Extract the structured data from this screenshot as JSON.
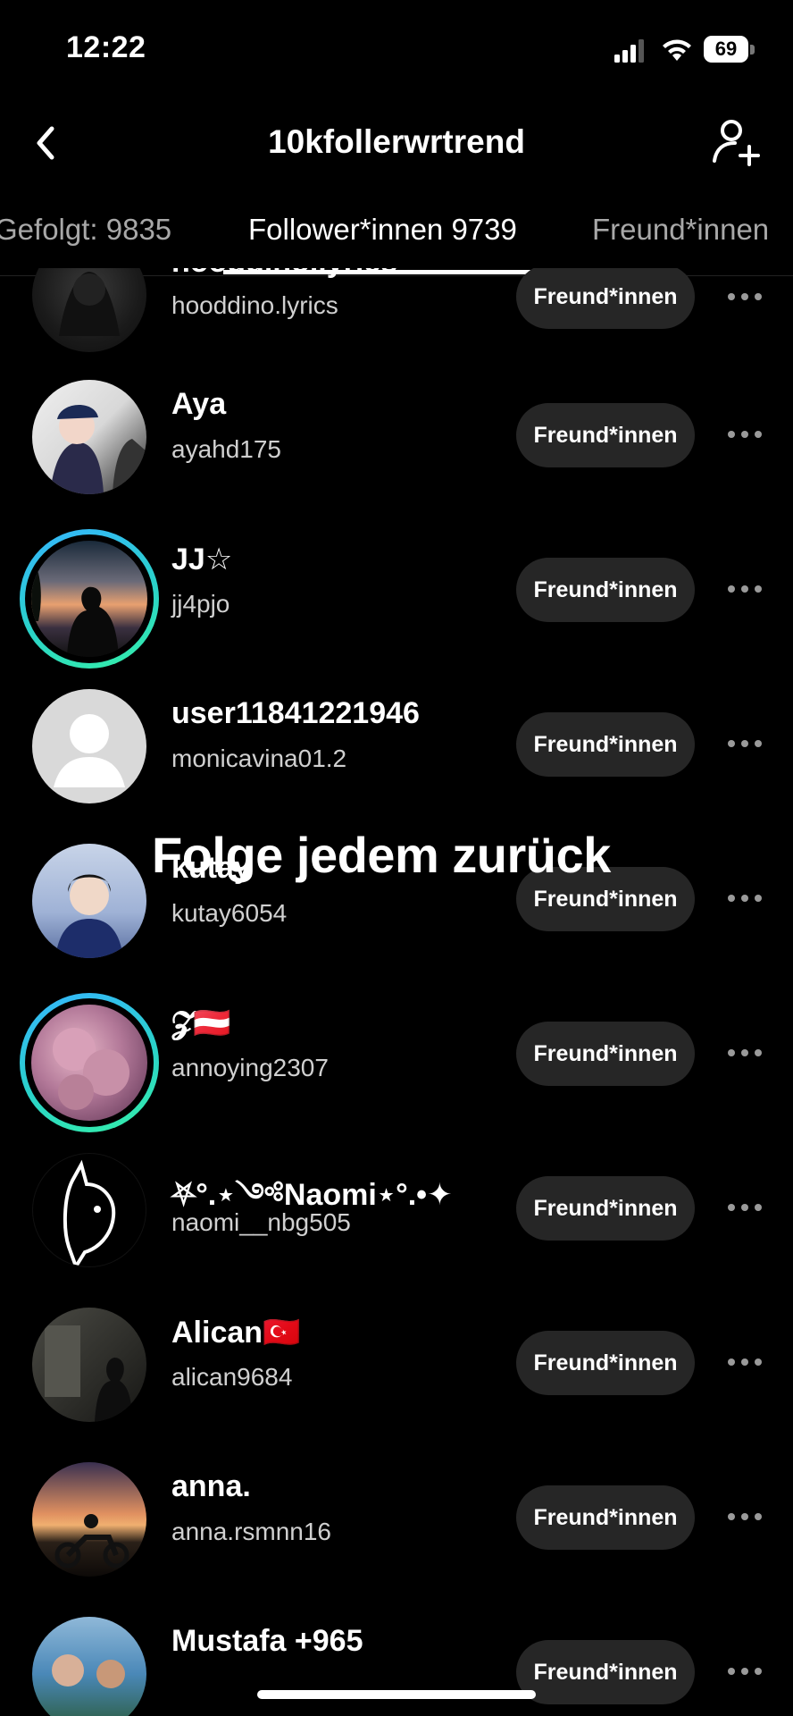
{
  "status": {
    "time": "12:22",
    "battery": "69"
  },
  "header": {
    "title": "10kfollerwrtrend"
  },
  "tabs": [
    {
      "label": "Gefolgt: 9835"
    },
    {
      "label": "Follower*innen 9739"
    },
    {
      "label": "Freund*innen"
    }
  ],
  "overlay_caption": "Folge jedem zurück",
  "rows": [
    {
      "name": "hooddino.lyrics",
      "handle": "hooddino.lyrics",
      "button": "Freund*innen"
    },
    {
      "name": "Aya",
      "handle": "ayahd175",
      "button": "Freund*innen"
    },
    {
      "name": "JJ☆",
      "handle": "jj4pjo",
      "button": "Freund*innen"
    },
    {
      "name": "user11841221946",
      "handle": "monicavina01.2",
      "button": "Freund*innen"
    },
    {
      "name": "kutay",
      "handle": "kutay6054",
      "button": "Freund*innen"
    },
    {
      "name": "𝓩🇦🇹",
      "handle": "annoying2307",
      "button": "Freund*innen"
    },
    {
      "name": "⛧°.⋆༺Naomi⋆°.•✦",
      "handle": "naomi__nbg505",
      "button": "Freund*innen"
    },
    {
      "name": "Alican🇹🇷",
      "handle": "alican9684",
      "button": "Freund*innen"
    },
    {
      "name": "anna.",
      "handle": "anna.rsmnn16",
      "button": "Freund*innen"
    },
    {
      "name": "Mustafa +965",
      "handle": "",
      "button": "Freund*innen"
    }
  ]
}
